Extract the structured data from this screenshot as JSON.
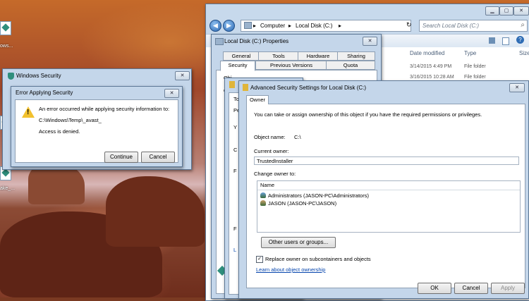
{
  "desktop": {
    "icons": [
      {
        "label": ""
      },
      {
        "label": "ows..."
      },
      {
        "label": ""
      },
      {
        "label": "ake_..."
      }
    ]
  },
  "explorer": {
    "breadcrumb": [
      "Computer",
      "Local Disk (C:)"
    ],
    "search_placeholder": "Search Local Disk (C:)",
    "columns": [
      "Date modified",
      "Type",
      "Size"
    ],
    "rows": [
      {
        "date": "3/14/2015 4:49 PM",
        "type": "File folder"
      },
      {
        "date": "3/16/2015 10:28 AM",
        "type": "File folder"
      }
    ]
  },
  "properties": {
    "title": "Local Disk (C:) Properties",
    "tabs_row1": [
      "General",
      "Tools",
      "Hardware",
      "Sharing"
    ],
    "tabs_row2": [
      "Security",
      "Previous Versions",
      "Quota"
    ],
    "active_tab": "Security",
    "fragments": [
      "Obj",
      "Gr",
      "To",
      "Pe",
      "Y",
      "C",
      "F",
      "F",
      "L"
    ]
  },
  "advanced": {
    "title": "Advanced Security Settings for Local Disk (C:)",
    "tab": "Owner",
    "intro": "You can take or assign ownership of this object if you have the required permissions or privileges.",
    "object_name_label": "Object name:",
    "object_name_value": "C:\\",
    "current_owner_label": "Current owner:",
    "current_owner_value": "TrustedInstaller",
    "change_owner_label": "Change owner to:",
    "list_header": "Name",
    "owners": [
      "Administrators (JASON-PC\\Administrators)",
      "JASON (JASON-PC\\JASON)"
    ],
    "other_users_button": "Other users or groups...",
    "replace_owner_label": "Replace owner on subcontainers and objects",
    "replace_owner_checked": true,
    "learn_link": "Learn about object ownership",
    "ok": "OK",
    "cancel": "Cancel",
    "apply": "Apply"
  },
  "windows_security": {
    "title": "Windows Security"
  },
  "error_dialog": {
    "title": "Error Applying Security",
    "message": "An error occurred while applying security information to:",
    "path": "C:\\Windows\\Temp\\_avast_",
    "detail": "Access is denied.",
    "continue": "Continue",
    "cancel": "Cancel"
  }
}
